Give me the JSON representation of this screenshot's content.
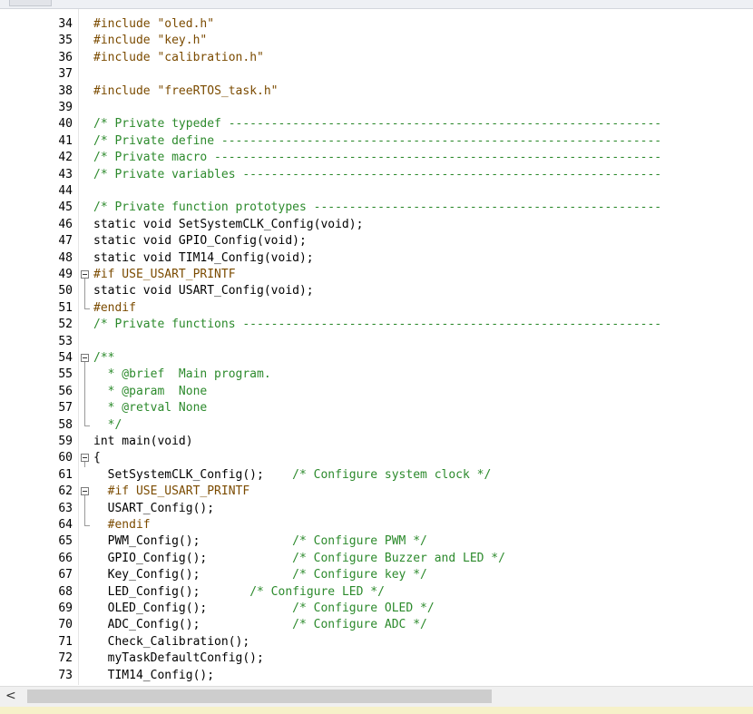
{
  "lines": [
    {
      "n": "34",
      "t": "#include \"oled.h\"",
      "k": "pp"
    },
    {
      "n": "35",
      "t": "#include \"key.h\"",
      "k": "pp"
    },
    {
      "n": "36",
      "t": "#include \"calibration.h\"",
      "k": "pp"
    },
    {
      "n": "37",
      "t": "",
      "k": ""
    },
    {
      "n": "38",
      "t": "#include \"freeRTOS_task.h\"",
      "k": "pp"
    },
    {
      "n": "39",
      "t": "",
      "k": ""
    },
    {
      "n": "40",
      "t": "/* Private typedef -------------------------------------------------------------",
      "k": "cm"
    },
    {
      "n": "41",
      "t": "/* Private define --------------------------------------------------------------",
      "k": "cm"
    },
    {
      "n": "42",
      "t": "/* Private macro ---------------------------------------------------------------",
      "k": "cm"
    },
    {
      "n": "43",
      "t": "/* Private variables -----------------------------------------------------------",
      "k": "cm"
    },
    {
      "n": "44",
      "t": "",
      "k": ""
    },
    {
      "n": "45",
      "t": "/* Private function prototypes -------------------------------------------------",
      "k": "cm"
    },
    {
      "n": "46",
      "t": "static void SetSystemCLK_Config(void);",
      "k": "code"
    },
    {
      "n": "47",
      "t": "static void GPIO_Config(void);",
      "k": "code"
    },
    {
      "n": "48",
      "t": "static void TIM14_Config(void);",
      "k": "code"
    },
    {
      "n": "49",
      "t": "#if USE_USART_PRINTF",
      "k": "pp",
      "fold": "box"
    },
    {
      "n": "50",
      "t": "static void USART_Config(void);",
      "k": "code",
      "fold": "line"
    },
    {
      "n": "51",
      "t": "#endif",
      "k": "pp",
      "fold": "end"
    },
    {
      "n": "52",
      "t": "/* Private functions -----------------------------------------------------------",
      "k": "cm"
    },
    {
      "n": "53",
      "t": "",
      "k": ""
    },
    {
      "n": "54",
      "t": "/**",
      "k": "cm",
      "fold": "box"
    },
    {
      "n": "55",
      "t": "  * @brief  Main program.",
      "k": "cm",
      "fold": "line"
    },
    {
      "n": "56",
      "t": "  * @param  None",
      "k": "cm",
      "fold": "line"
    },
    {
      "n": "57",
      "t": "  * @retval None",
      "k": "cm",
      "fold": "line"
    },
    {
      "n": "58",
      "t": "  */",
      "k": "cm",
      "fold": "end"
    },
    {
      "n": "59",
      "t": "int main(void)",
      "k": "code"
    },
    {
      "n": "60",
      "t": "{",
      "k": "code",
      "fold": "box"
    },
    {
      "n": "61",
      "t": "  SetSystemCLK_Config();    /* Configure system clock */",
      "k": "mixed",
      "split": 27
    },
    {
      "n": "62",
      "t": "  #if USE_USART_PRINTF",
      "k": "pp",
      "fold": "box"
    },
    {
      "n": "63",
      "t": "  USART_Config();",
      "k": "code",
      "fold": "line"
    },
    {
      "n": "64",
      "t": "  #endif",
      "k": "pp",
      "fold": "end"
    },
    {
      "n": "65",
      "t": "  PWM_Config();             /* Configure PWM */",
      "k": "mixed",
      "split": 27
    },
    {
      "n": "66",
      "t": "  GPIO_Config();            /* Configure Buzzer and LED */",
      "k": "mixed",
      "split": 27
    },
    {
      "n": "67",
      "t": "  Key_Config();             /* Configure key */",
      "k": "mixed",
      "split": 27
    },
    {
      "n": "68",
      "t": "  LED_Config();       /* Configure LED */",
      "k": "mixed",
      "split": 21
    },
    {
      "n": "69",
      "t": "  OLED_Config();            /* Configure OLED */",
      "k": "mixed",
      "split": 27
    },
    {
      "n": "70",
      "t": "  ADC_Config();             /* Configure ADC */",
      "k": "mixed",
      "split": 27
    },
    {
      "n": "71",
      "t": "  Check_Calibration();",
      "k": "code"
    },
    {
      "n": "72",
      "t": "  myTaskDefaultConfig();",
      "k": "code"
    },
    {
      "n": "73",
      "t": "  TIM14_Config();",
      "k": "code"
    }
  ],
  "scrollbar": {
    "left_arrow": "<"
  },
  "colors": {
    "comment": "#2c8a2c",
    "preprocessor": "#7b4b00",
    "code": "#000000",
    "background": "#ffffff"
  }
}
